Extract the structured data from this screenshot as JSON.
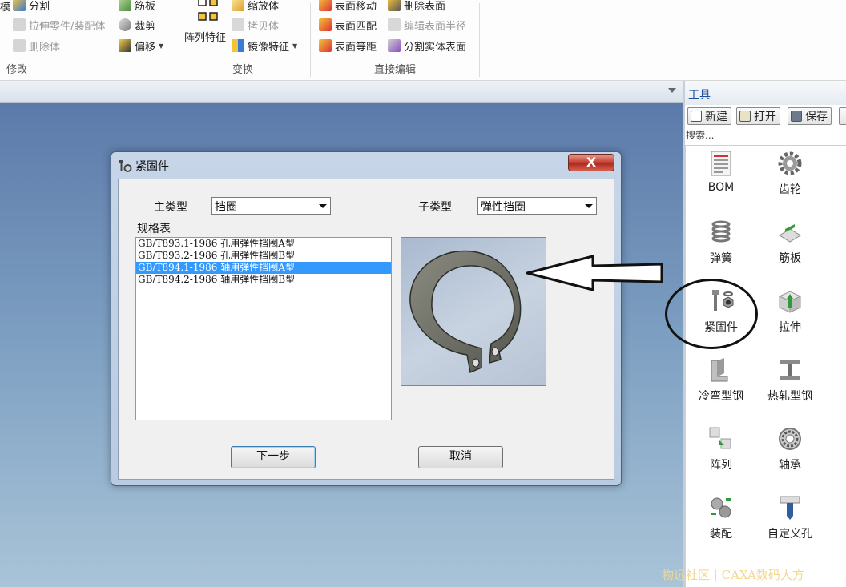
{
  "ribbon": {
    "modify": {
      "partial_label": "模",
      "split": "分割",
      "stretch_part": "拉伸零件/装配体",
      "delete_body": "删除体",
      "rib": "筋板",
      "trim": "裁剪",
      "offset": "偏移",
      "title": "修改"
    },
    "transform": {
      "array_feature": "阵列特征",
      "scale_body": "缩放体",
      "copy_body": "拷贝体",
      "mirror_feature": "镜像特征",
      "title": "变换"
    },
    "direct_edit": {
      "move_face": "表面移动",
      "match_face": "表面匹配",
      "offset_face": "表面等距",
      "delete_face": "删除表面",
      "edit_face_radius": "编辑表面半径",
      "split_solid_face": "分割实体表面",
      "title": "直接编辑"
    }
  },
  "panel": {
    "title": "工具",
    "buttons": {
      "new": "新建",
      "open": "打开",
      "save": "保存"
    },
    "search_label": "搜索...",
    "items": [
      {
        "label": "BOM",
        "icon": "bom-icon"
      },
      {
        "label": "齿轮",
        "icon": "gear-icon"
      },
      {
        "label": "弹簧",
        "icon": "spring-icon"
      },
      {
        "label": "筋板",
        "icon": "rib-icon"
      },
      {
        "label": "紧固件",
        "icon": "fastener-icon"
      },
      {
        "label": "拉伸",
        "icon": "extrude-icon"
      },
      {
        "label": "冷弯型钢",
        "icon": "cold-bent-steel-icon"
      },
      {
        "label": "热轧型钢",
        "icon": "hot-rolled-steel-icon"
      },
      {
        "label": "阵列",
        "icon": "array-icon"
      },
      {
        "label": "轴承",
        "icon": "bearing-icon"
      },
      {
        "label": "装配",
        "icon": "assembly-icon"
      },
      {
        "label": "自定义孔",
        "icon": "custom-hole-icon"
      }
    ]
  },
  "dialog": {
    "title": "紧固件",
    "close_label": "X",
    "main_type_label": "主类型",
    "main_type_value": "挡圈",
    "sub_type_label": "子类型",
    "sub_type_value": "弹性挡圈",
    "spec_table_label": "规格表",
    "spec_items": [
      "GB/T893.1-1986 孔用弹性挡圈A型",
      "GB/T893.2-1986 孔用弹性挡圈B型",
      "GB/T894.1-1986 轴用弹性挡圈A型",
      "GB/T894.2-1986 轴用弹性挡圈B型"
    ],
    "selected_index": 2,
    "next_label": "下一步",
    "cancel_label": "取消"
  },
  "watermark": "物远社区 | CAXA数码大方",
  "colors": {
    "selection": "#3399ff",
    "panel_title": "#1c4f9e",
    "viewport_top": "#5c7aaa",
    "viewport_bottom": "#a9c4d8",
    "close_button": "#c9453a"
  }
}
